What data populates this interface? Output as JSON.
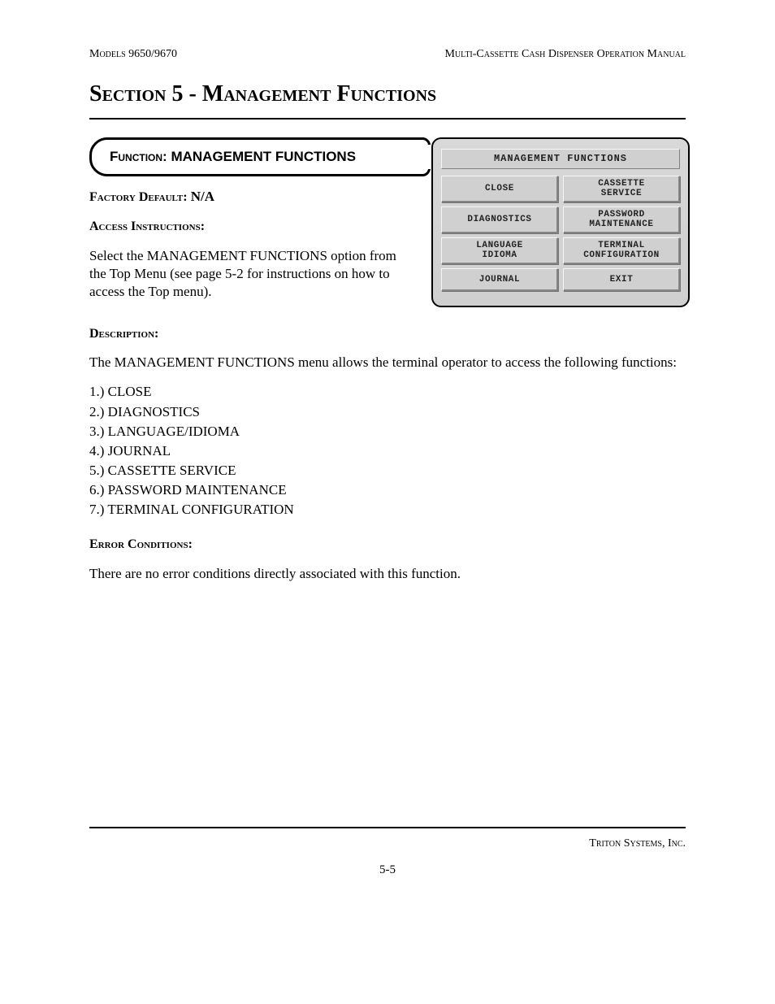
{
  "header": {
    "left": "Models 9650/9670",
    "right": "Multi-Cassette Cash Dispenser Operation Manual"
  },
  "section_title": "Section 5 - Management Functions",
  "function_box": {
    "prefix": "Function:",
    "name": "MANAGEMENT FUNCTIONS"
  },
  "factory_default": {
    "label": "Factory Default:",
    "value": "N/A"
  },
  "access_instructions": {
    "label": "Access Instructions:",
    "text": "Select the MANAGEMENT FUNCTIONS option from the Top Menu (see page 5-2 for instructions on how to access the Top menu)."
  },
  "description": {
    "label": "Description:",
    "text": "The MANAGEMENT FUNCTIONS menu allows the terminal operator to access the following functions:"
  },
  "function_list": [
    "1.) CLOSE",
    "2.) DIAGNOSTICS",
    "3.) LANGUAGE/IDIOMA",
    "4.) JOURNAL",
    "5.) CASSETTE SERVICE",
    "6.) PASSWORD MAINTENANCE",
    "7.) TERMINAL CONFIGURATION"
  ],
  "error_conditions": {
    "label": "Error Conditions:",
    "text": "There are no error conditions directly associated with this function."
  },
  "screen": {
    "title": "MANAGEMENT FUNCTIONS",
    "buttons": [
      "CLOSE",
      "CASSETTE\nSERVICE",
      "DIAGNOSTICS",
      "PASSWORD\nMAINTENANCE",
      "LANGUAGE\nIDIOMA",
      "TERMINAL\nCONFIGURATION",
      "JOURNAL",
      "EXIT"
    ]
  },
  "footer": {
    "company": "Triton Systems, Inc.",
    "page": "5-5"
  }
}
